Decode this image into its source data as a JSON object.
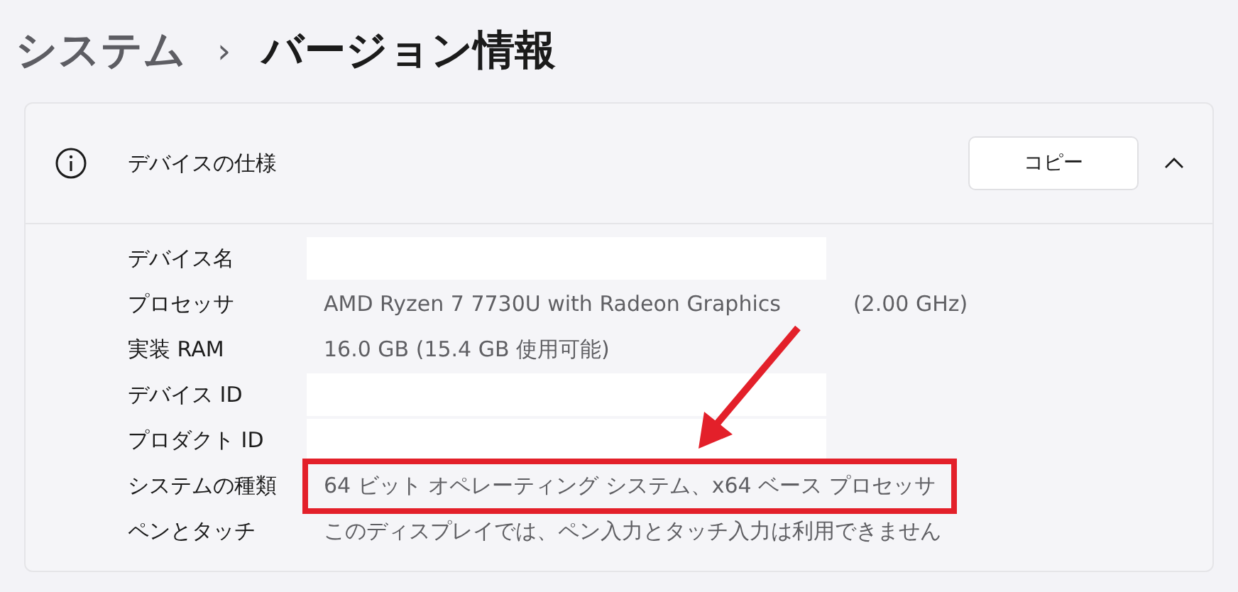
{
  "breadcrumb": {
    "parent": "システム",
    "separator": "›",
    "current": "バージョン情報"
  },
  "section": {
    "title": "デバイスの仕様",
    "copy_button": "コピー",
    "expanded": true,
    "rows": [
      {
        "label": "デバイス名",
        "kind": "redacted",
        "highlighted": false
      },
      {
        "label": "プロセッサ",
        "kind": "text",
        "value": "AMD Ryzen 7 7730U with Radeon Graphics",
        "extra": "(2.00 GHz)",
        "highlighted": false
      },
      {
        "label": "実装 RAM",
        "kind": "text",
        "value": "16.0 GB (15.4 GB 使用可能)",
        "highlighted": false
      },
      {
        "label": "デバイス ID",
        "kind": "redacted",
        "highlighted": false
      },
      {
        "label": "プロダクト ID",
        "kind": "redacted",
        "highlighted": false
      },
      {
        "label": "システムの種類",
        "kind": "text",
        "value": "64 ビット オペレーティング システム、x64 ベース プロセッサ",
        "highlighted": true
      },
      {
        "label": "ペンとタッチ",
        "kind": "text",
        "value": "このディスプレイでは、ペン入力とタッチ入力は利用できません",
        "highlighted": false
      }
    ]
  }
}
